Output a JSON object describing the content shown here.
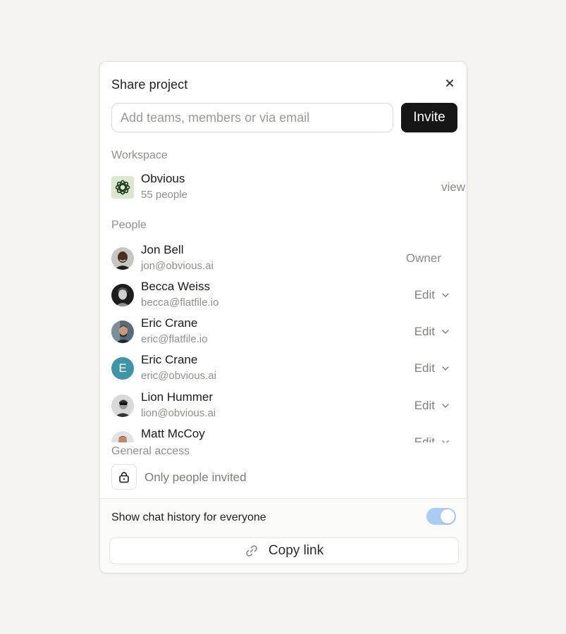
{
  "dialog": {
    "title": "Share project",
    "close_icon": "close-icon"
  },
  "invite": {
    "placeholder": "Add teams, members or via email",
    "value": "",
    "button_label": "Invite"
  },
  "workspace": {
    "section_label": "Workspace",
    "name": "Obvious",
    "members": "55 people",
    "permission": "view",
    "logo_color": "#dbe8cf"
  },
  "people": {
    "section_label": "People",
    "items": [
      {
        "name": "Jon Bell",
        "email": "jon@obvious.ai",
        "role": "Owner"
      },
      {
        "name": "Becca Weiss",
        "email": "becca@flatfile.io",
        "role": "Edit"
      },
      {
        "name": "Eric Crane",
        "email": "eric@flatfile.io",
        "role": "Edit"
      },
      {
        "name": "Eric Crane",
        "email": "eric@obvious.ai",
        "role": "Edit",
        "initial": "E",
        "avatar_color": "#3f94a6"
      },
      {
        "name": "Lion Hummer",
        "email": "lion@obvious.ai",
        "role": "Edit"
      },
      {
        "name": "Matt McCoy",
        "email": "",
        "role": "Edit"
      }
    ]
  },
  "general_access": {
    "section_label": "General access",
    "value": "Only people invited",
    "icon": "lock-icon"
  },
  "footer": {
    "chat_history_label": "Show chat history for everyone",
    "chat_history_enabled": true,
    "toggle_color": "#a9cdf7",
    "copy_link_label": "Copy link",
    "copy_link_icon": "link-icon"
  }
}
